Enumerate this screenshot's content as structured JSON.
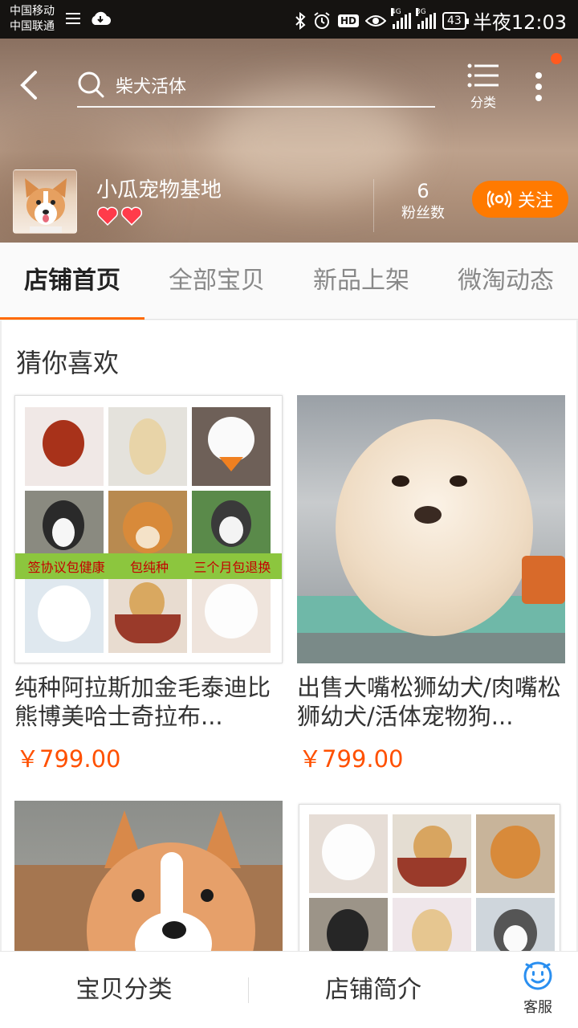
{
  "status_bar": {
    "carrier1": "中国移动",
    "carrier2": "中国联通",
    "hd": "HD",
    "net1": "4G",
    "net2": "3G",
    "battery": "43",
    "time": "半夜12:03"
  },
  "header": {
    "search_text": "柴犬活体",
    "category_label": "分类",
    "shop_name": "小瓜宠物基地",
    "hearts": 2,
    "fans_count": "6",
    "fans_label": "粉丝数",
    "follow_label": "关注"
  },
  "tabs": [
    {
      "label": "店铺首页",
      "active": true
    },
    {
      "label": "全部宝贝",
      "active": false
    },
    {
      "label": "新品上架",
      "active": false
    },
    {
      "label": "微淘动态",
      "active": false
    }
  ],
  "section_title": "猜你喜欢",
  "products": [
    {
      "title": "纯种阿拉斯加金毛泰迪比熊博美哈士奇拉布...",
      "price": "￥799.00",
      "banner": [
        "签协议包健康",
        "包纯种",
        "三个月包退换"
      ]
    },
    {
      "title": "出售大嘴松狮幼犬/肉嘴松狮幼犬/活体宠物狗...",
      "price": "￥799.00"
    },
    {
      "title": "",
      "price": ""
    },
    {
      "title": "",
      "price": ""
    }
  ],
  "bottom_bar": {
    "category": "宝贝分类",
    "intro": "店铺简介",
    "service": "客服"
  },
  "colors": {
    "accent": "#ff7a00",
    "price": "#ff5000",
    "tab_indicator": "#ff6a00"
  }
}
